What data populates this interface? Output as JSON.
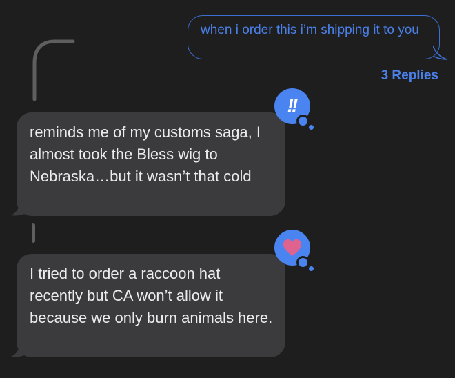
{
  "thread": {
    "outgoing_message": {
      "text": "when i order this i’m shipping it to you",
      "replies_label": "3 Replies"
    },
    "replies": [
      {
        "text": "reminds me of my customs saga, I almost took the Bless wig to Nebraska…but it wasn’t that cold",
        "tapback": "exclamation-icon"
      },
      {
        "text": "I tried to order a raccoon hat recently but CA won’t allow it because we only burn animals here.",
        "tapback": "heart-icon"
      }
    ]
  },
  "colors": {
    "accent": "#4a84f0",
    "bubble": "#3b3b3d",
    "background": "#1e1e1e",
    "heart": "#e0628f"
  },
  "tapback_glyphs": {
    "exclamation": "!!"
  }
}
